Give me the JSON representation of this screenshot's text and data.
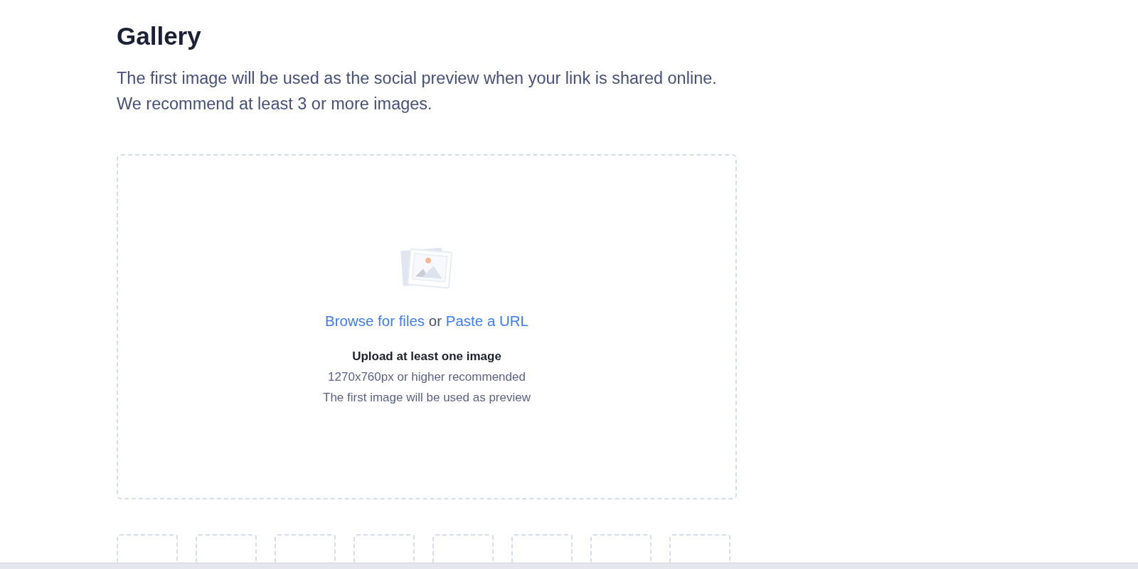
{
  "section": {
    "title": "Gallery",
    "description": [
      "The first image will be used as the social preview when your link is shared online.",
      "We recommend at least 3 or more images."
    ]
  },
  "dropzone": {
    "prompt": [
      {
        "kind": "link",
        "text": "Browse for files"
      },
      {
        "kind": "text",
        "text": "or"
      },
      {
        "kind": "link",
        "text": "Paste a URL"
      }
    ],
    "requirement": "Upload at least one image",
    "hints": [
      "1270x760px or higher recommended",
      "The first image will be used as preview"
    ]
  },
  "thumbnails": [
    {
      "filled": false
    },
    {
      "filled": false
    },
    {
      "filled": false
    },
    {
      "filled": false
    },
    {
      "filled": false
    },
    {
      "filled": false
    },
    {
      "filled": false
    },
    {
      "filled": false
    }
  ]
}
